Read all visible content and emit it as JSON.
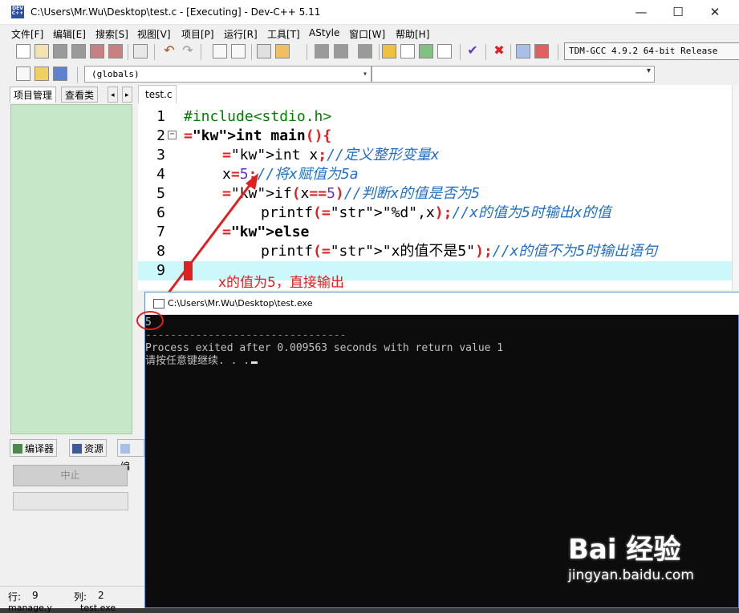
{
  "window": {
    "title": "C:\\Users\\Mr.Wu\\Desktop\\test.c - [Executing] - Dev-C++ 5.11",
    "minimize": "—",
    "maximize": "☐",
    "close": "✕"
  },
  "menu": [
    "文件[F]",
    "编辑[E]",
    "搜索[S]",
    "视图[V]",
    "项目[P]",
    "运行[R]",
    "工具[T]",
    "AStyle",
    "窗口[W]",
    "帮助[H]"
  ],
  "compiler": "TDM-GCC 4.9.2 64-bit Release",
  "globals_combo": "(globals)",
  "left_tabs": {
    "project": "项目管理",
    "classes": "查看类"
  },
  "file_tab": "test.c",
  "code_lines": [
    {
      "n": "1",
      "text": "#include<stdio.h>"
    },
    {
      "n": "2",
      "text": "int main(){"
    },
    {
      "n": "3",
      "text": "int x;//定义整形变量x"
    },
    {
      "n": "4",
      "text": "x=5;//将x赋值为5a"
    },
    {
      "n": "5",
      "text": "if(x==5)//判断x的值是否为5"
    },
    {
      "n": "6",
      "text": "printf(\"%d\",x);//x的值为5时输出x的值"
    },
    {
      "n": "7",
      "text": "else"
    },
    {
      "n": "8",
      "text": "printf(\"x的值不是5\");//x的值不为5时输出语句"
    },
    {
      "n": "9",
      "text": "}"
    }
  ],
  "annotation": "x的值为5，直接输出",
  "bottom_tabs": {
    "compiler": "编译器",
    "resources": "资源",
    "log": "编"
  },
  "abort_button": "中止",
  "status": {
    "row_label": "行:",
    "row": "9",
    "col_label": "列:",
    "col": "2",
    "bottom_left": "manage.y",
    "bottom_mid": "test.exe"
  },
  "console": {
    "title": "C:\\Users\\Mr.Wu\\Desktop\\test.exe",
    "output": "5",
    "divider": "--------------------------------",
    "exit_line": "Process exited after 0.009563 seconds with return value 1",
    "prompt": "请按任意键继续. . ."
  },
  "watermark": {
    "brand": "Bai 经验",
    "url": "jingyan.baidu.com"
  },
  "colors": {
    "annotation_red": "#e02020",
    "comment_blue": "#1e6fc8",
    "tree_green": "#c7e8c8",
    "current_line": "#ccf7fb"
  }
}
